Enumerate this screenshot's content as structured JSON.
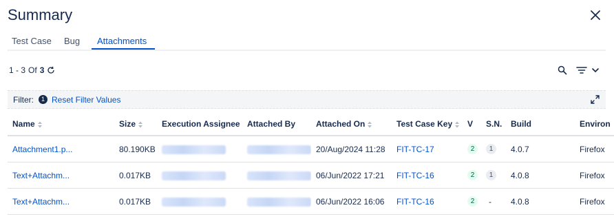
{
  "header": {
    "title": "Summary"
  },
  "tabs": [
    {
      "label": "Test Case"
    },
    {
      "label": "Bug"
    },
    {
      "label": "Attachments"
    }
  ],
  "pager": {
    "range": "1 - 3",
    "of_label": "Of",
    "total": "3"
  },
  "filter": {
    "label": "Filter:",
    "count": "1",
    "reset_label": "Reset Filter Values"
  },
  "table": {
    "columns": [
      "Name",
      "Size",
      "Execution Assignee",
      "Attached By",
      "Attached On",
      "Test Case Key",
      "V",
      "S.N.",
      "Build",
      "Environ"
    ],
    "rows": [
      {
        "name": "Attachment1.p...",
        "size": "80.190KB",
        "attached_on": "20/Aug/2024 11:28",
        "key": "FIT-TC-17",
        "v": "2",
        "sn": "1",
        "build": "4.0.7",
        "env": "Firefox"
      },
      {
        "name": "Text+Attachm...",
        "size": "0.017KB",
        "attached_on": "06/Jun/2022 17:21",
        "key": "FIT-TC-16",
        "v": "2",
        "sn": "1",
        "build": "4.0.8",
        "env": "Firefox"
      },
      {
        "name": "Text+Attachm...",
        "size": "0.017KB",
        "attached_on": "06/Jun/2022 16:06",
        "key": "FIT-TC-16",
        "v": "2",
        "sn": "-",
        "build": "4.0.8",
        "env": "Firefox"
      }
    ]
  },
  "colors": {
    "accent": "#0052cc",
    "text": "#172b4d",
    "success_bg": "#e3fcef",
    "success_text": "#006644"
  }
}
